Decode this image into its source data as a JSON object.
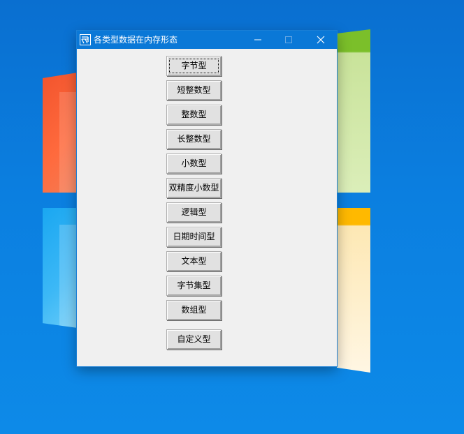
{
  "window": {
    "title": "各类型数据在内存形态",
    "controls": {
      "minimize": "—",
      "maximize": "☐",
      "close": "✕"
    }
  },
  "buttons": [
    {
      "label": "字节型"
    },
    {
      "label": "短整数型"
    },
    {
      "label": "整数型"
    },
    {
      "label": "长整数型"
    },
    {
      "label": "小数型"
    },
    {
      "label": "双精度小数型"
    },
    {
      "label": "逻辑型"
    },
    {
      "label": "日期时间型"
    },
    {
      "label": "文本型"
    },
    {
      "label": "字节集型"
    },
    {
      "label": "数组型"
    },
    {
      "label": "自定义型"
    }
  ],
  "colors": {
    "titlebar": "#0a78d7",
    "client": "#f0f0f0",
    "desktop": "#0b7fe0"
  }
}
